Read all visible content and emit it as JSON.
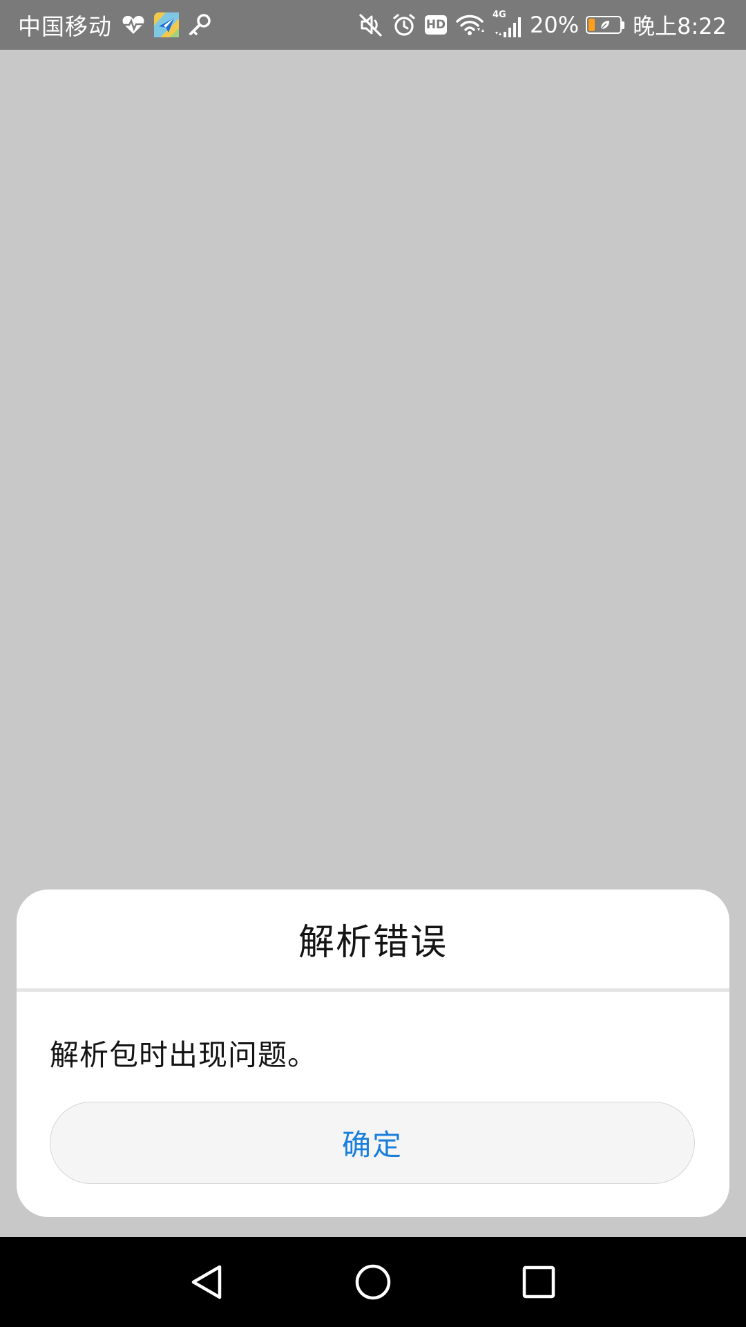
{
  "status_bar": {
    "carrier": "中国移动",
    "network_type": "4G",
    "battery_percent": "20%",
    "time": "晚上8:22",
    "hd_label": "HD",
    "battery_level": 0.2,
    "battery_level_color": "#ff9f1a",
    "left_icons": [
      "heart-health-icon",
      "travel-app-icon",
      "key-icon"
    ],
    "right_icons": [
      "mute-icon",
      "alarm-icon",
      "hd-icon",
      "wifi-icon",
      "signal-icon",
      "battery-icon"
    ]
  },
  "dialog": {
    "title": "解析错误",
    "message": "解析包时出现问题。",
    "ok_label": "确定",
    "accent_color": "#1a7fdb"
  },
  "nav_bar": {
    "icons": [
      "back-triangle-icon",
      "home-circle-icon",
      "recents-square-icon"
    ]
  }
}
